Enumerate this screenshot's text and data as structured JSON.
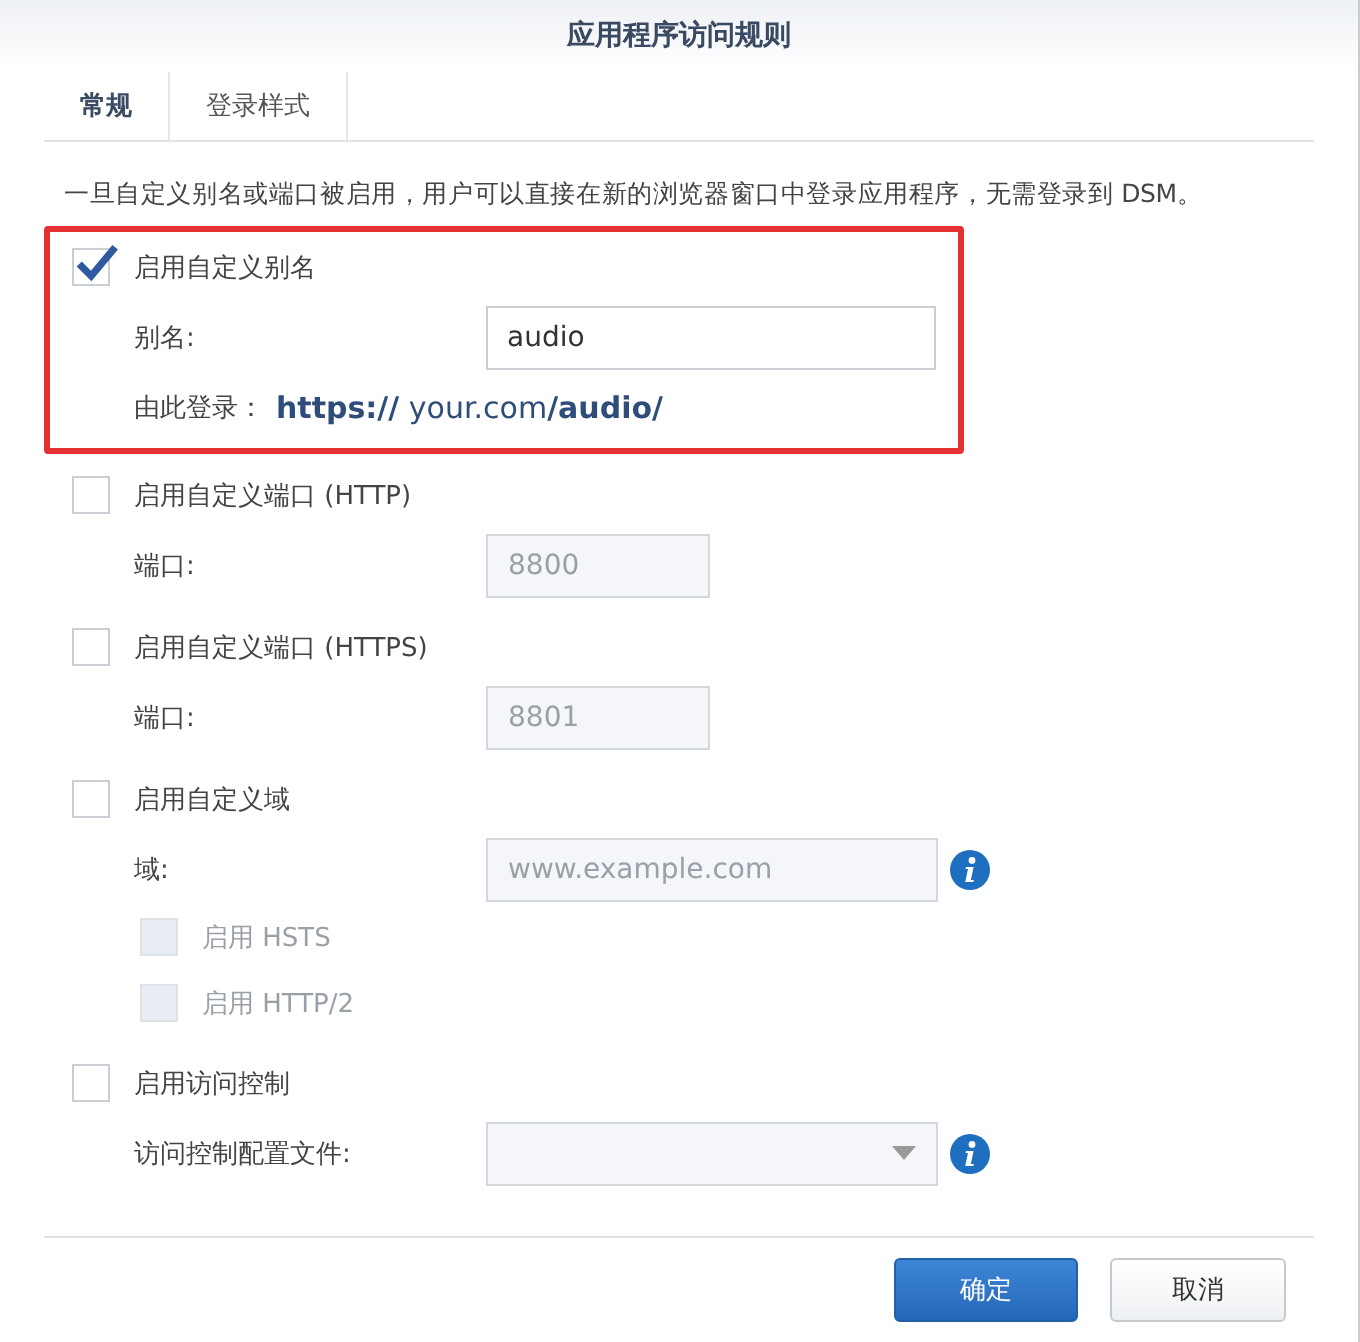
{
  "window": {
    "title": "应用程序访问规则"
  },
  "tabs": [
    {
      "label": "常规",
      "selected": true
    },
    {
      "label": "登录样式",
      "selected": false
    }
  ],
  "description": "一旦自定义别名或端口被启用，用户可以直接在新的浏览器窗口中登录应用程序，无需登录到 DSM。",
  "groups": [
    {
      "highlighted": true,
      "rows": [
        {
          "kind": "checkbox",
          "label": "启用自定义别名",
          "checked": true,
          "disabled": false
        },
        {
          "kind": "field",
          "label": "别名:",
          "value": "audio",
          "disabled": false
        },
        {
          "kind": "link",
          "label": "由此登录：",
          "url": "**https://** your.com**/audio/**"
        }
      ]
    },
    {
      "rows": [
        {
          "kind": "checkbox",
          "label": "启用自定义端口 (HTTP)",
          "checked": false,
          "disabled": false
        },
        {
          "kind": "field",
          "label": "端口:",
          "value": "8800",
          "disabled": true
        }
      ]
    },
    {
      "rows": [
        {
          "kind": "checkbox",
          "label": "启用自定义端口 (HTTPS)",
          "checked": false,
          "disabled": false
        },
        {
          "kind": "field",
          "label": "端口:",
          "value": "8801",
          "disabled": true
        }
      ]
    },
    {
      "rows": [
        {
          "kind": "checkbox",
          "label": "启用自定义域",
          "checked": false,
          "disabled": false
        },
        {
          "kind": "field",
          "label": "域:",
          "placeholder": "www.example.com",
          "disabled": true,
          "info": true
        },
        {
          "kind": "subcheckbox",
          "label": "启用 HSTS",
          "checked": false,
          "disabled": true
        },
        {
          "kind": "subcheckbox",
          "label": "启用 HTTP/2",
          "checked": false,
          "disabled": true
        }
      ]
    },
    {
      "rows": [
        {
          "kind": "checkbox",
          "label": "启用访问控制",
          "checked": false,
          "disabled": false
        },
        {
          "kind": "select",
          "label": "访问控制配置文件:",
          "disabled": true,
          "info": true
        }
      ]
    }
  ],
  "buttons": [
    {
      "label": "确定",
      "kind": "primary"
    },
    {
      "label": "取消",
      "kind": "secondary"
    }
  ]
}
